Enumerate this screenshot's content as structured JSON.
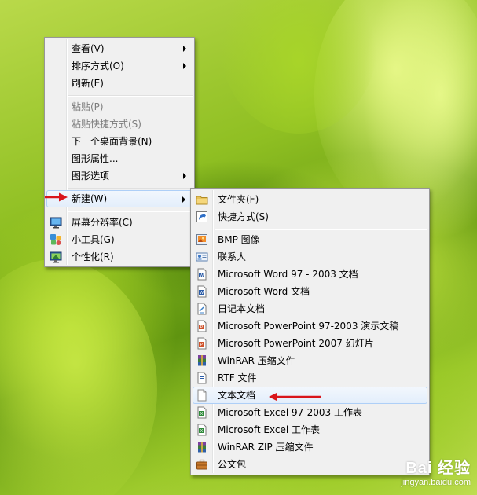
{
  "desktop_menu": {
    "items": [
      {
        "label": "查看(V)",
        "submenu": true
      },
      {
        "label": "排序方式(O)",
        "submenu": true
      },
      {
        "label": "刷新(E)"
      },
      {
        "label": "粘贴(P)",
        "disabled": true
      },
      {
        "label": "粘贴快捷方式(S)",
        "disabled": true
      },
      {
        "label": "下一个桌面背景(N)"
      },
      {
        "label": "图形属性..."
      },
      {
        "label": "图形选项",
        "submenu": true
      },
      {
        "label": "新建(W)",
        "submenu": true,
        "highlighted": true
      },
      {
        "label": "屏幕分辨率(C)",
        "icon": "monitor-icon"
      },
      {
        "label": "小工具(G)",
        "icon": "gadgets-icon"
      },
      {
        "label": "个性化(R)",
        "icon": "personalize-icon"
      }
    ]
  },
  "new_submenu": {
    "items": [
      {
        "label": "文件夹(F)",
        "icon": "folder-icon"
      },
      {
        "label": "快捷方式(S)",
        "icon": "shortcut-icon"
      },
      {
        "label": "BMP 图像",
        "icon": "bmp-image-icon"
      },
      {
        "label": "联系人",
        "icon": "contact-icon"
      },
      {
        "label": "Microsoft Word 97 - 2003 文档",
        "icon": "word-doc-icon"
      },
      {
        "label": "Microsoft Word 文档",
        "icon": "word-doc-icon"
      },
      {
        "label": "日记本文档",
        "icon": "journal-icon"
      },
      {
        "label": "Microsoft PowerPoint 97-2003 演示文稿",
        "icon": "powerpoint-icon"
      },
      {
        "label": "Microsoft PowerPoint 2007 幻灯片",
        "icon": "powerpoint-icon"
      },
      {
        "label": "WinRAR 压缩文件",
        "icon": "winrar-icon"
      },
      {
        "label": "RTF 文件",
        "icon": "rtf-icon"
      },
      {
        "label": "文本文档",
        "icon": "text-document-icon",
        "highlighted": true
      },
      {
        "label": "Microsoft Excel 97-2003 工作表",
        "icon": "excel-icon"
      },
      {
        "label": "Microsoft Excel 工作表",
        "icon": "excel-icon"
      },
      {
        "label": "WinRAR ZIP 压缩文件",
        "icon": "winrar-zip-icon"
      },
      {
        "label": "公文包",
        "icon": "briefcase-icon"
      }
    ]
  },
  "watermark": {
    "brand": "Bai 经验",
    "url": "jingyan.baidu.com"
  },
  "colors": {
    "annotation_arrow": "#d9151b",
    "highlight_border": "#aecff7",
    "menu_background": "#f0f0f0"
  }
}
